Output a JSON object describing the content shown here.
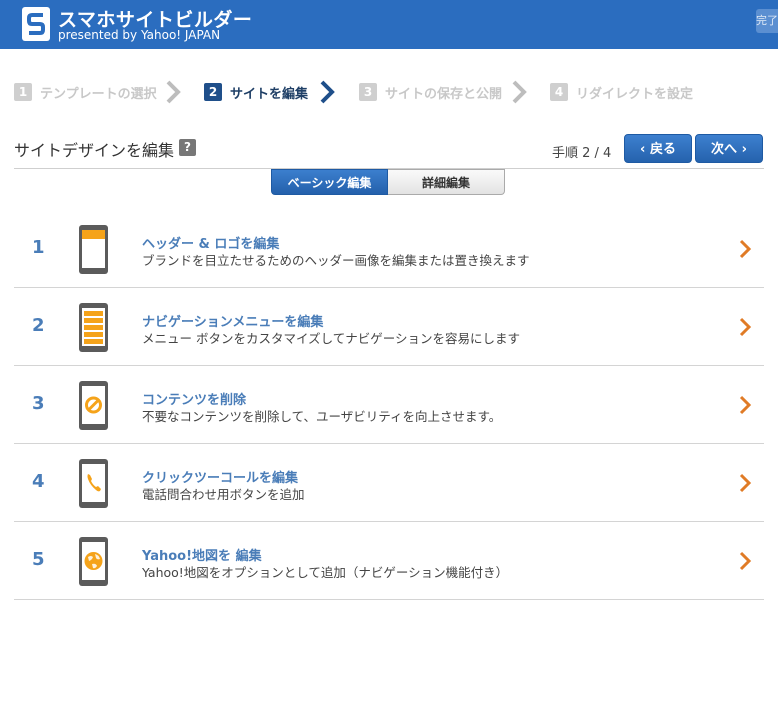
{
  "app": {
    "title": "スマホサイトビルダー",
    "subtitle": "presented by Yahoo! JAPAN",
    "done_label": "完了"
  },
  "steps": [
    {
      "num": "1",
      "label": "テンプレートの選択",
      "state": "inactive"
    },
    {
      "num": "2",
      "label": "サイトを編集",
      "state": "active"
    },
    {
      "num": "3",
      "label": "サイトの保存と公開",
      "state": "inactive"
    },
    {
      "num": "4",
      "label": "リダイレクトを設定",
      "state": "inactive"
    }
  ],
  "page": {
    "title": "サイトデザインを編集",
    "help": "?",
    "step_count": "手順 2 / 4",
    "back_label": "戻る",
    "next_label": "次へ"
  },
  "tabs": {
    "basic": "ベーシック編集",
    "detail": "詳細編集"
  },
  "items": [
    {
      "index": "1",
      "title": "ヘッダー & ロゴを編集",
      "desc": "ブランドを目立たせるためのヘッダー画像を編集または置き換えます",
      "icon": "header-icon"
    },
    {
      "index": "2",
      "title": "ナビゲーションメニューを編集",
      "desc": "メニュー ボタンをカスタマイズしてナビゲーションを容易にします",
      "icon": "menu-icon"
    },
    {
      "index": "3",
      "title": "コンテンツを削除",
      "desc": "不要なコンテンツを削除して、ユーザビリティを向上させます。",
      "icon": "prohibit-icon"
    },
    {
      "index": "4",
      "title": "クリックツーコールを編集",
      "desc": "電話問合わせ用ボタンを追加",
      "icon": "phone-call-icon"
    },
    {
      "index": "5",
      "title": "Yahoo!地図を 編集",
      "desc": "Yahoo!地図をオプションとして追加（ナビゲーション機能付き）",
      "icon": "globe-icon"
    }
  ],
  "colors": {
    "header_bg": "#2b6dbf",
    "accent": "#4a7db8",
    "orange": "#f5a31a",
    "arrow": "#e07b26"
  }
}
